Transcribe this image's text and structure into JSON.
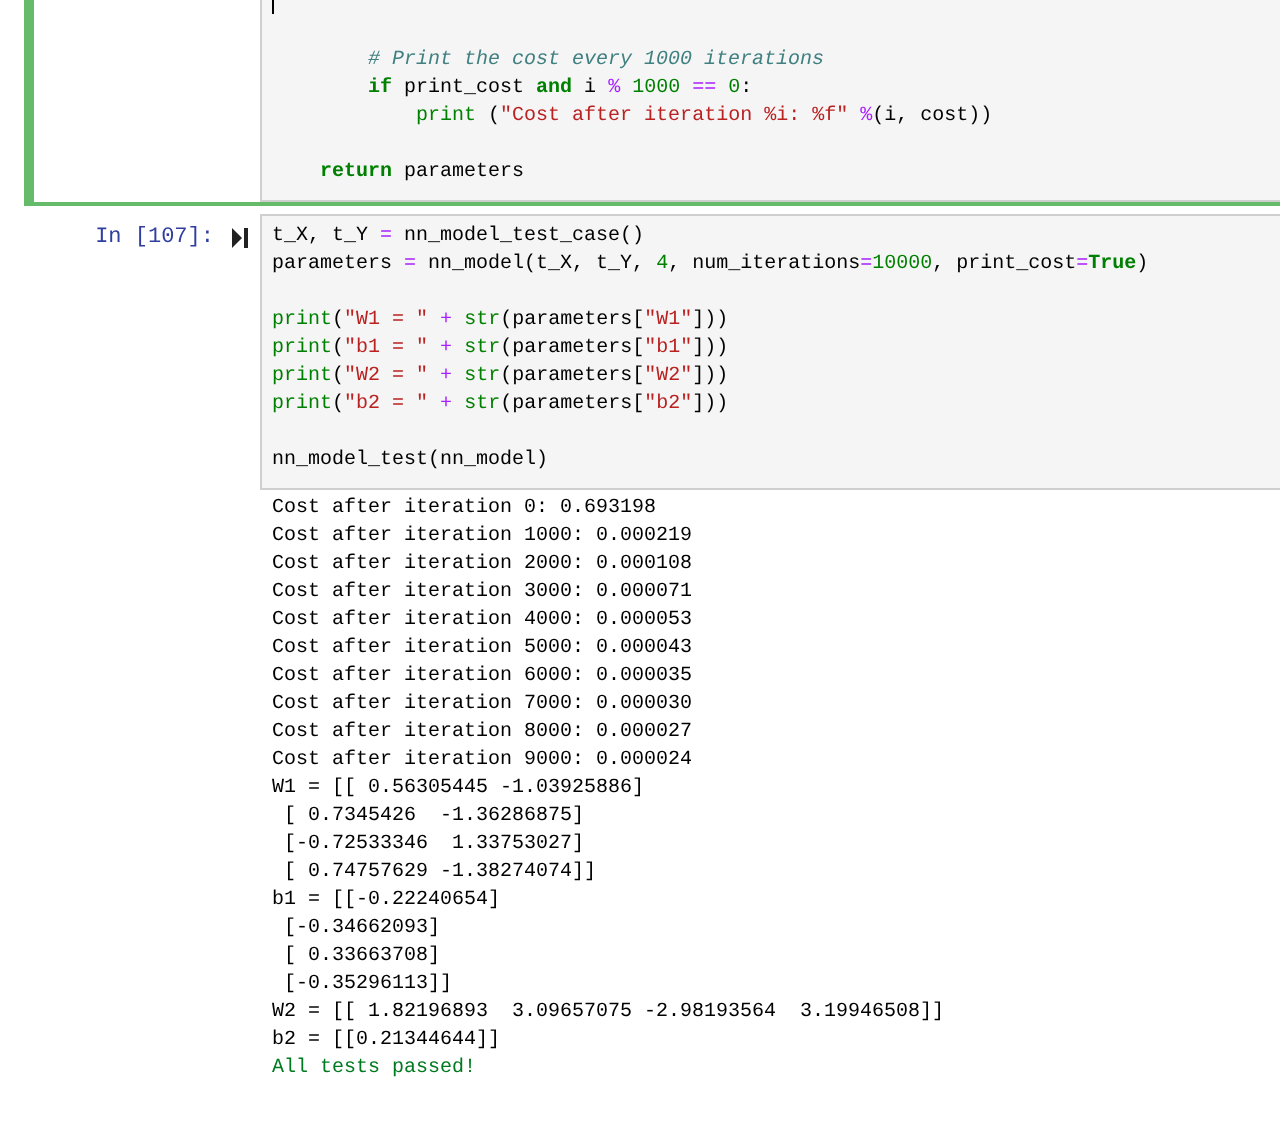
{
  "cells": [
    {
      "selected": true,
      "editing": true,
      "code": [
        {
          "gap_before": true,
          "tokens": [
            {
              "kind": "cm",
              "text": "        # Print the cost every 1000 iterations"
            }
          ]
        },
        {
          "tokens": [
            {
              "kind": "kw",
              "text": "        if"
            },
            {
              "kind": "p",
              "text": " print_cost "
            },
            {
              "kind": "kw",
              "text": "and"
            },
            {
              "kind": "p",
              "text": " i "
            },
            {
              "kind": "op",
              "text": "%"
            },
            {
              "kind": "num",
              "text": " 1000"
            },
            {
              "kind": "op",
              "text": " =="
            },
            {
              "kind": "num",
              "text": " 0"
            },
            {
              "kind": "p",
              "text": ":"
            }
          ]
        },
        {
          "tokens": [
            {
              "kind": "bi",
              "text": "            print"
            },
            {
              "kind": "p",
              "text": " ("
            },
            {
              "kind": "str",
              "text": "\"Cost after iteration %i: %f\""
            },
            {
              "kind": "op",
              "text": " %"
            },
            {
              "kind": "p",
              "text": "(i, cost))"
            }
          ]
        },
        {
          "gap_before": true,
          "tokens": [
            {
              "kind": "kw",
              "text": "    return"
            },
            {
              "kind": "p",
              "text": " parameters"
            }
          ]
        }
      ]
    },
    {
      "selected": false,
      "editing": false,
      "prompt": "In [107]:",
      "code": [
        {
          "tokens": [
            {
              "kind": "p",
              "text": "t_X, t_Y "
            },
            {
              "kind": "op",
              "text": "="
            },
            {
              "kind": "p",
              "text": " nn_model_test_case()"
            }
          ]
        },
        {
          "tokens": [
            {
              "kind": "p",
              "text": "parameters "
            },
            {
              "kind": "op",
              "text": "="
            },
            {
              "kind": "p",
              "text": " nn_model(t_X, t_Y, "
            },
            {
              "kind": "num",
              "text": "4"
            },
            {
              "kind": "p",
              "text": ", num_iterations"
            },
            {
              "kind": "op",
              "text": "="
            },
            {
              "kind": "num",
              "text": "10000"
            },
            {
              "kind": "p",
              "text": ", print_cost"
            },
            {
              "kind": "op",
              "text": "="
            },
            {
              "kind": "kw",
              "text": "True"
            },
            {
              "kind": "p",
              "text": ")"
            }
          ]
        },
        {
          "gap_before": true,
          "tokens": [
            {
              "kind": "bi",
              "text": "print"
            },
            {
              "kind": "p",
              "text": "("
            },
            {
              "kind": "str",
              "text": "\"W1 = \""
            },
            {
              "kind": "op",
              "text": " +"
            },
            {
              "kind": "bi",
              "text": " str"
            },
            {
              "kind": "p",
              "text": "(parameters["
            },
            {
              "kind": "str",
              "text": "\"W1\""
            },
            {
              "kind": "p",
              "text": "]))"
            }
          ]
        },
        {
          "tokens": [
            {
              "kind": "bi",
              "text": "print"
            },
            {
              "kind": "p",
              "text": "("
            },
            {
              "kind": "str",
              "text": "\"b1 = \""
            },
            {
              "kind": "op",
              "text": " +"
            },
            {
              "kind": "bi",
              "text": " str"
            },
            {
              "kind": "p",
              "text": "(parameters["
            },
            {
              "kind": "str",
              "text": "\"b1\""
            },
            {
              "kind": "p",
              "text": "]))"
            }
          ]
        },
        {
          "tokens": [
            {
              "kind": "bi",
              "text": "print"
            },
            {
              "kind": "p",
              "text": "("
            },
            {
              "kind": "str",
              "text": "\"W2 = \""
            },
            {
              "kind": "op",
              "text": " +"
            },
            {
              "kind": "bi",
              "text": " str"
            },
            {
              "kind": "p",
              "text": "(parameters["
            },
            {
              "kind": "str",
              "text": "\"W2\""
            },
            {
              "kind": "p",
              "text": "]))"
            }
          ]
        },
        {
          "tokens": [
            {
              "kind": "bi",
              "text": "print"
            },
            {
              "kind": "p",
              "text": "("
            },
            {
              "kind": "str",
              "text": "\"b2 = \""
            },
            {
              "kind": "op",
              "text": " +"
            },
            {
              "kind": "bi",
              "text": " str"
            },
            {
              "kind": "p",
              "text": "(parameters["
            },
            {
              "kind": "str",
              "text": "\"b2\""
            },
            {
              "kind": "p",
              "text": "]))"
            }
          ]
        },
        {
          "gap_before": true,
          "tokens": [
            {
              "kind": "p",
              "text": "nn_model_test(nn_model)"
            }
          ]
        }
      ],
      "output": [
        {
          "kind": "stdout",
          "text": "Cost after iteration 0: 0.693198"
        },
        {
          "kind": "stdout",
          "text": "Cost after iteration 1000: 0.000219"
        },
        {
          "kind": "stdout",
          "text": "Cost after iteration 2000: 0.000108"
        },
        {
          "kind": "stdout",
          "text": "Cost after iteration 3000: 0.000071"
        },
        {
          "kind": "stdout",
          "text": "Cost after iteration 4000: 0.000053"
        },
        {
          "kind": "stdout",
          "text": "Cost after iteration 5000: 0.000043"
        },
        {
          "kind": "stdout",
          "text": "Cost after iteration 6000: 0.000035"
        },
        {
          "kind": "stdout",
          "text": "Cost after iteration 7000: 0.000030"
        },
        {
          "kind": "stdout",
          "text": "Cost after iteration 8000: 0.000027"
        },
        {
          "kind": "stdout",
          "text": "Cost after iteration 9000: 0.000024"
        },
        {
          "kind": "stdout",
          "text": "W1 = [[ 0.56305445 -1.03925886]"
        },
        {
          "kind": "stdout",
          "text": " [ 0.7345426  -1.36286875]"
        },
        {
          "kind": "stdout",
          "text": " [-0.72533346  1.33753027]"
        },
        {
          "kind": "stdout",
          "text": " [ 0.74757629 -1.38274074]]"
        },
        {
          "kind": "stdout",
          "text": "b1 = [[-0.22240654]"
        },
        {
          "kind": "stdout",
          "text": " [-0.34662093]"
        },
        {
          "kind": "stdout",
          "text": " [ 0.33663708]"
        },
        {
          "kind": "stdout",
          "text": " [-0.35296113]]"
        },
        {
          "kind": "stdout",
          "text": "W2 = [[ 1.82196893  3.09657075 -2.98193564  3.19946508]]"
        },
        {
          "kind": "stdout",
          "text": "b2 = [[0.21344644]]"
        },
        {
          "kind": "success",
          "text": "All tests passed!"
        }
      ]
    }
  ]
}
